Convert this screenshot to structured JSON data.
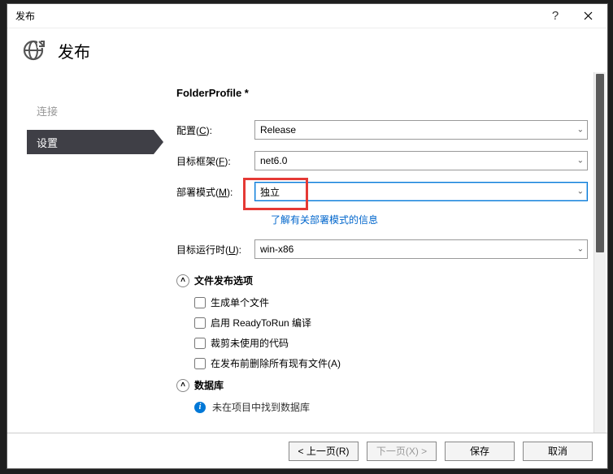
{
  "window": {
    "title": "发布"
  },
  "header": {
    "title": "发布"
  },
  "sidebar": {
    "link_connect": "连接",
    "active": "设置"
  },
  "profile": {
    "title": "FolderProfile *"
  },
  "form": {
    "config": {
      "label_pre": "配置(",
      "label_u": "C",
      "label_post": "):",
      "value": "Release"
    },
    "target_fw": {
      "label_pre": "目标框架(",
      "label_u": "F",
      "label_post": "):",
      "value": "net6.0"
    },
    "deploy_mode": {
      "label_pre": "部署模式(",
      "label_u": "M",
      "label_post": "):",
      "value": "独立"
    },
    "deploy_info_link": "了解有关部署模式的信息",
    "runtime": {
      "label_pre": "目标运行时(",
      "label_u": "U",
      "label_post": "):",
      "value": "win-x86"
    }
  },
  "file_opts": {
    "title": "文件发布选项",
    "items": [
      "生成单个文件",
      "启用 ReadyToRun 编译",
      "裁剪未使用的代码",
      "在发布前删除所有现有文件(A)"
    ]
  },
  "db": {
    "title": "数据库",
    "info": "未在项目中找到数据库"
  },
  "footer": {
    "prev": "< 上一页(R)",
    "next": "下一页(X) >",
    "save": "保存",
    "cancel": "取消"
  }
}
